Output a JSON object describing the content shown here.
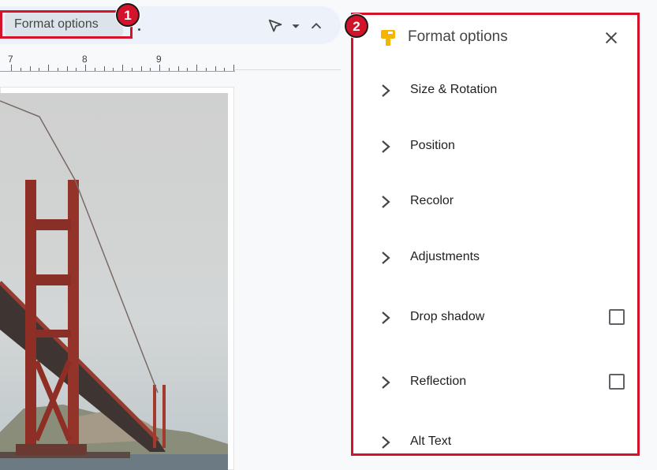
{
  "toolbar": {
    "format_options_label": "Format options",
    "icons": [
      "select-pointer-icon",
      "dropdown-caret-icon",
      "chevron-up-icon"
    ]
  },
  "ruler": {
    "labels": [
      "7",
      "8",
      "9"
    ]
  },
  "annotations": {
    "badge1": "1",
    "badge2": "2",
    "highlight_color": "#d3132a"
  },
  "panel": {
    "title": "Format options",
    "icon": "paint-roller-icon",
    "icon_color": "#f4b400",
    "close_icon": "close-icon",
    "sections": [
      {
        "label": "Size & Rotation",
        "checkbox": false
      },
      {
        "label": "Position",
        "checkbox": false
      },
      {
        "label": "Recolor",
        "checkbox": false
      },
      {
        "label": "Adjustments",
        "checkbox": false
      },
      {
        "label": "Drop shadow",
        "checkbox": true,
        "checked": false
      },
      {
        "label": "Reflection",
        "checkbox": true,
        "checked": false
      },
      {
        "label": "Alt Text",
        "checkbox": false
      }
    ]
  },
  "image": {
    "description": "Golden Gate Bridge in fog"
  }
}
